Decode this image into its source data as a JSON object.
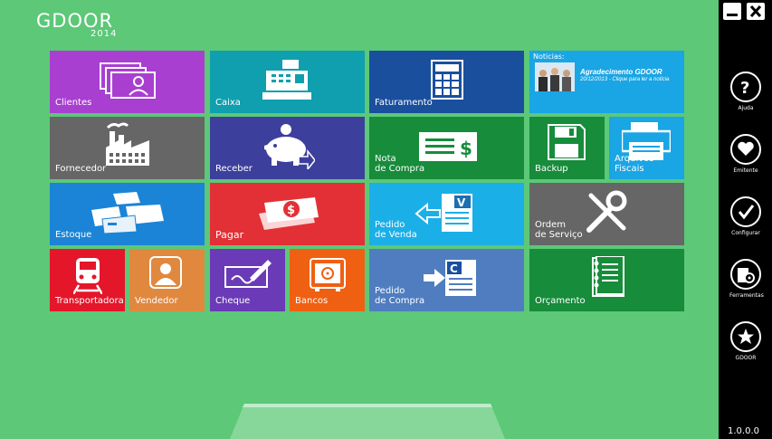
{
  "app": {
    "logo_name": "GDOOR",
    "logo_year": "2014",
    "version": "1.0.0.0"
  },
  "tiles": {
    "clientes": "Clientes",
    "caixa": "Caixa",
    "faturamento": "Faturamento",
    "fornecedor": "Fornecedor",
    "receber": "Receber",
    "nota_compra": "Nota\nde Compra",
    "backup": "Backup",
    "arquivos_fiscais": "Arquivos\nFiscais",
    "estoque": "Estoque",
    "pagar": "Pagar",
    "pedido_venda": "Pedido\nde Venda",
    "ordem_servico": "Ordem\nde Serviço",
    "transportadora": "Transportadora",
    "vendedor": "Vendedor",
    "cheque": "Cheque",
    "bancos": "Bancos",
    "pedido_compra": "Pedido\nde Compra",
    "orcamento": "Orçamento"
  },
  "news": {
    "header": "Noticias:",
    "title": "Agradecimento GDOOR",
    "subtitle": "20/12/2013 - Clique para ler a noticia"
  },
  "sidebar": {
    "ajuda": "Ajuda",
    "emitente": "Emitente",
    "configurar": "Configurar",
    "ferramentas": "Ferramentas",
    "gdoor": "GDOOR"
  },
  "icons": [
    "clients-icon",
    "cash-register-icon",
    "calculator-icon",
    "factory-icon",
    "piggy-bank-icon",
    "invoice-icon",
    "floppy-disk-icon",
    "printer-icon",
    "boxes-icon",
    "money-icon",
    "sales-order-icon",
    "tools-icon",
    "train-icon",
    "person-icon",
    "cheque-icon",
    "safe-icon",
    "purchase-order-icon",
    "notebook-icon",
    "help-icon",
    "heart-icon",
    "check-icon",
    "tools-gear-icon",
    "star-icon"
  ],
  "colors": {
    "background": "#5cc878",
    "purple": "#a93fd1",
    "teal": "#0f9fae",
    "navy": "#1a4f9e",
    "gray": "#666666",
    "indigo": "#3d3f9d",
    "green": "#178c3b",
    "sky": "#1aa5e4",
    "blue": "#1b84d6",
    "red": "#e33036",
    "light_blue": "#1bafe8",
    "crimson": "#e4162a",
    "orange": "#e1883f",
    "violet": "#6a3ab7",
    "deep_orange": "#f06012",
    "steel": "#4f7dc0"
  }
}
